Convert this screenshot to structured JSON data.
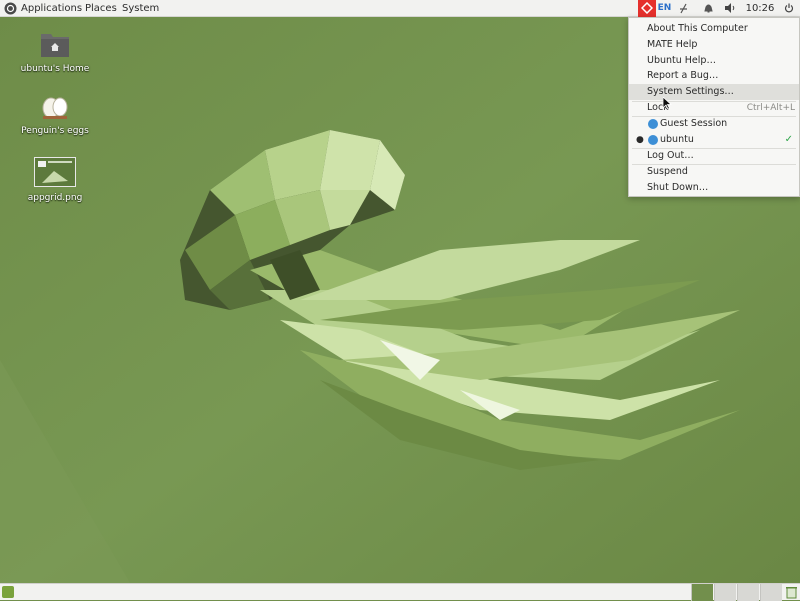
{
  "top_panel": {
    "menus": {
      "applications": "Applications",
      "places": "Places",
      "system": "System"
    },
    "language": "EN",
    "clock": "10:26"
  },
  "desktop": {
    "icons": [
      {
        "label": "ubuntu's Home",
        "icon": "home-folder-icon"
      },
      {
        "label": "Penguin's eggs",
        "icon": "eggs-icon"
      },
      {
        "label": "appgrid.png",
        "icon": "image-file-icon"
      }
    ]
  },
  "user_menu": {
    "about": "About This Computer",
    "mate_help": "MATE Help",
    "ubuntu_help": "Ubuntu Help…",
    "report_bug": "Report a Bug…",
    "system_settings": "System Settings…",
    "lock": "Lock",
    "lock_accel": "Ctrl+Alt+L",
    "guest_session": "Guest Session",
    "current_user": "ubuntu",
    "log_out": "Log Out…",
    "suspend": "Suspend",
    "shut_down": "Shut Down…"
  },
  "colors": {
    "wallpaper": "#728f4c",
    "remote_indicator": "#e5302c",
    "accent_blue": "#3d8fd6",
    "check_green": "#2fa64a"
  }
}
